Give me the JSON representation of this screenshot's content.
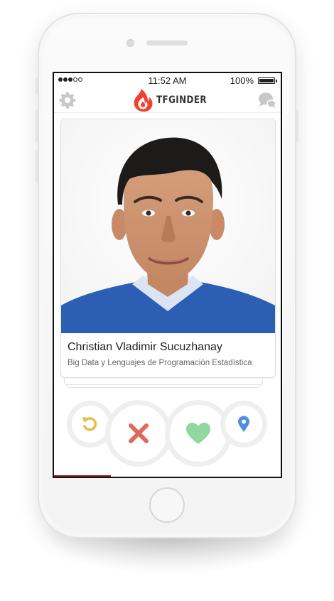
{
  "status_bar": {
    "signal_filled": 3,
    "signal_total": 5,
    "time": "11:52 AM",
    "battery_percent": "100%"
  },
  "nav": {
    "app_name": "TFGINDER",
    "left_icon": "gear-icon",
    "right_icon": "chat-bubbles-icon",
    "logo_icon": "flame-icon"
  },
  "profile": {
    "name": "Christian Vladimir Sucuzhanay",
    "subtitle": "Big Data y Lenguajes de Programación Estadística",
    "photo_icon": "profile-photo"
  },
  "actions": [
    {
      "icon": "undo-icon",
      "color": "#e2c04c"
    },
    {
      "icon": "close-icon",
      "color": "#dc6b5d"
    },
    {
      "icon": "heart-icon",
      "color": "#8fd9a1"
    },
    {
      "icon": "location-pin-icon",
      "color": "#4d8ee0"
    }
  ],
  "colors": {
    "brand": "#f0432f",
    "icon_gray": "#c8c8c8",
    "shirt_blue": "#2c5fb4"
  }
}
